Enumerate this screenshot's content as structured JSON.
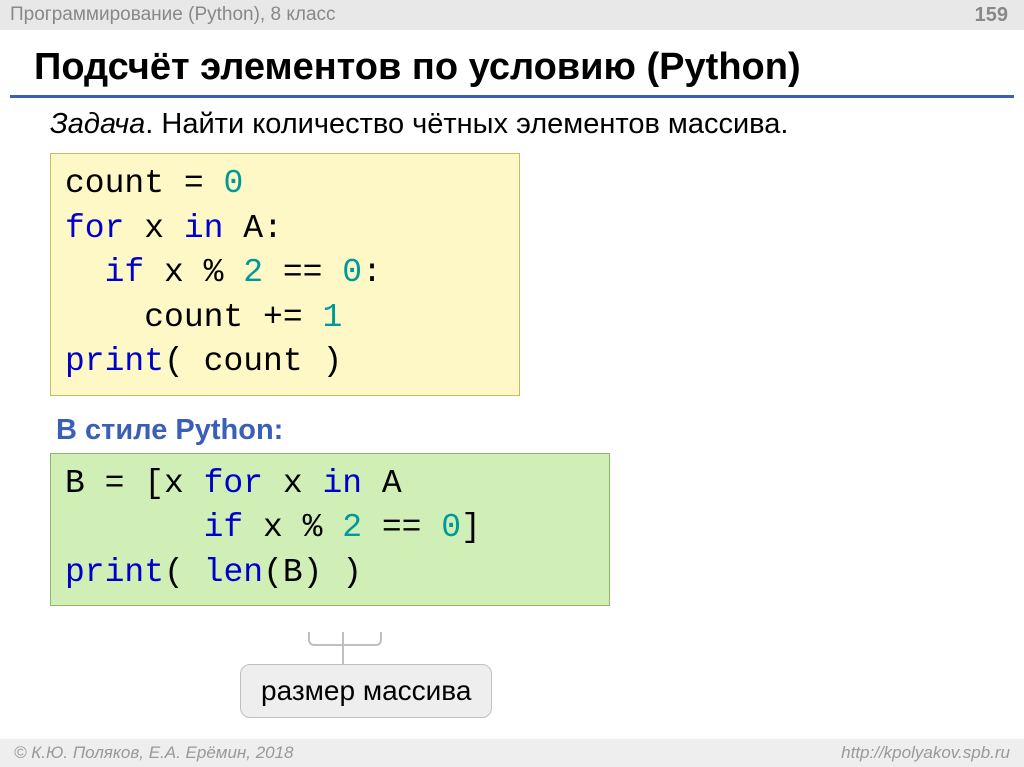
{
  "header": {
    "subject": "Программирование (Python), 8 класс",
    "page": "159"
  },
  "title": "Подсчёт элементов по условию (Python)",
  "task": {
    "label": "Задача",
    "text": ". Найти количество чётных элементов массива."
  },
  "code1": {
    "l1a": "count = ",
    "l1b": "0",
    "l2a": "for",
    "l2b": " x ",
    "l2c": "in",
    "l2d": " A:",
    "l3a": "  if",
    "l3b": " x % ",
    "l3c": "2",
    "l3d": " == ",
    "l3e": "0",
    "l3f": ":",
    "l4a": "    count += ",
    "l4b": "1",
    "l5a": "print",
    "l5b": "( count )"
  },
  "subhead": "В стиле Python:",
  "code2": {
    "l1a": "B = [x ",
    "l1b": "for",
    "l1c": " x ",
    "l1d": "in",
    "l1e": " A",
    "l2a": "       if",
    "l2b": " x % ",
    "l2c": "2",
    "l2d": " == ",
    "l2e": "0",
    "l2f": "]",
    "l3a": "print",
    "l3b": "( ",
    "l3c": "len",
    "l3d": "(B) )"
  },
  "callout": "размер массива",
  "footer": {
    "left": "© К.Ю. Поляков, Е.А. Ерёмин, 2018",
    "right": "http://kpolyakov.spb.ru"
  }
}
